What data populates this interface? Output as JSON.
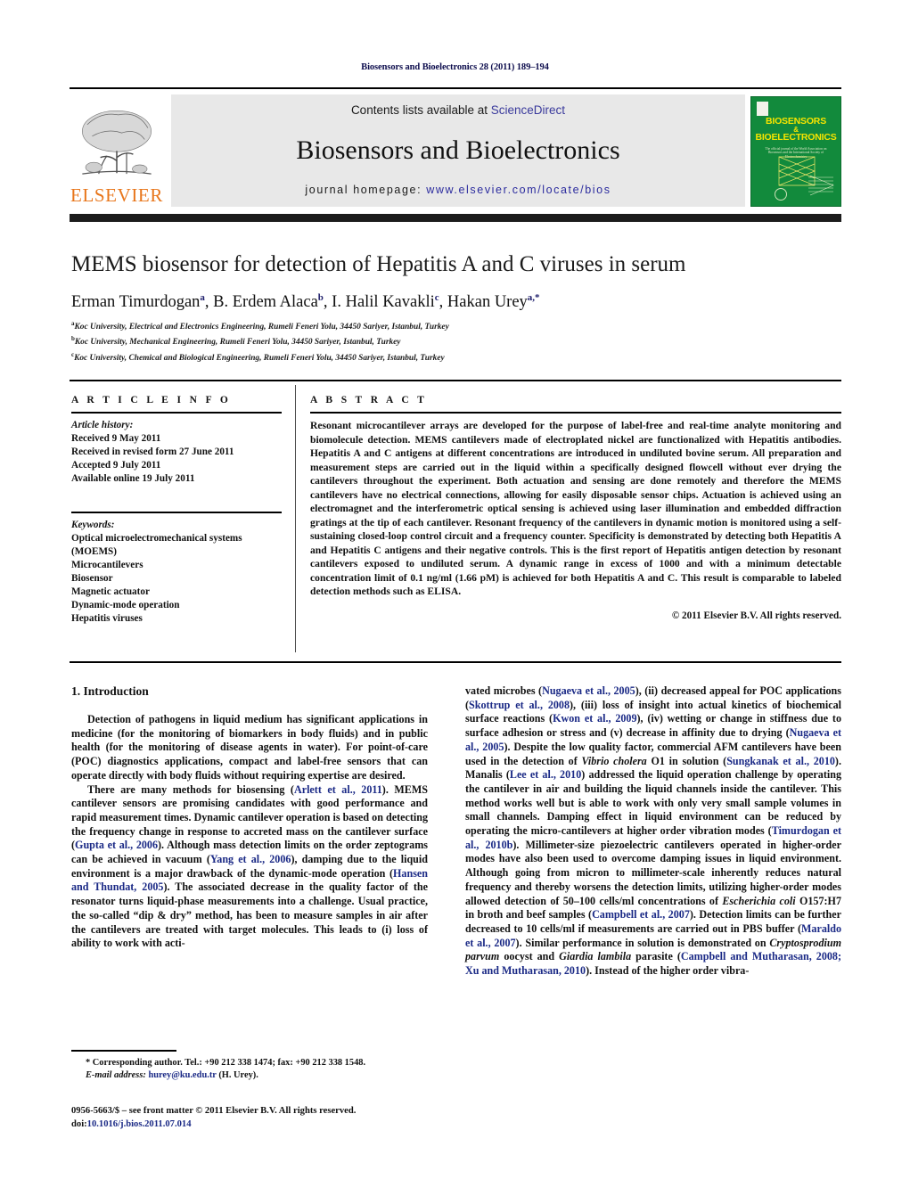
{
  "running_head": "Biosensors and Bioelectronics 28 (2011) 189–194",
  "masthead": {
    "contents_prefix": "Contents lists available at ",
    "sciencedirect": "ScienceDirect",
    "journal_name": "Biosensors and Bioelectronics",
    "homepage_prefix": "journal homepage: ",
    "homepage_url": "www.elsevier.com/locate/bios",
    "publisher": "ELSEVIER",
    "cover": {
      "line1": "BIOSENSORS",
      "amp": "&",
      "line2": "BIOELECTRONICS",
      "subtitle": "The official journal of the World Association on Biosensors and the International Society of Electrochemistry"
    },
    "accent_orange": "#e8761b",
    "accent_blue": "#2b2b9e",
    "cover_green": "#128a3c",
    "cover_yellow": "#f6e400"
  },
  "article": {
    "title": "MEMS biosensor for detection of Hepatitis A and C viruses in serum",
    "authors": [
      {
        "name": "Erman Timurdogan",
        "sup": "a"
      },
      {
        "name": "B. Erdem Alaca",
        "sup": "b"
      },
      {
        "name": "I. Halil Kavakli",
        "sup": "c"
      },
      {
        "name": "Hakan Urey",
        "sup": "a,*"
      }
    ],
    "affiliations": [
      {
        "sup": "a",
        "text": "Koc University, Electrical and Electronics Engineering, Rumeli Feneri Yolu, 34450 Sariyer, Istanbul, Turkey"
      },
      {
        "sup": "b",
        "text": "Koc University, Mechanical Engineering, Rumeli Feneri Yolu, 34450 Sariyer, Istanbul, Turkey"
      },
      {
        "sup": "c",
        "text": "Koc University, Chemical and Biological Engineering, Rumeli Feneri Yolu, 34450 Sariyer, Istanbul, Turkey"
      }
    ]
  },
  "article_info": {
    "heading": "A R T I C L E    I N F O",
    "history_label": "Article history:",
    "history": [
      "Received 9 May 2011",
      "Received in revised form 27 June 2011",
      "Accepted 9 July 2011",
      "Available online 19 July 2011"
    ],
    "keywords_label": "Keywords:",
    "keywords": [
      "Optical microelectromechanical systems",
      "(MOEMS)",
      "Microcantilevers",
      "Biosensor",
      "Magnetic actuator",
      "Dynamic-mode operation",
      "Hepatitis viruses"
    ]
  },
  "abstract": {
    "heading": "A B S T R A C T",
    "text": "Resonant microcantilever arrays are developed for the purpose of label-free and real-time analyte monitoring and biomolecule detection. MEMS cantilevers made of electroplated nickel are functionalized with Hepatitis antibodies. Hepatitis A and C antigens at different concentrations are introduced in undiluted bovine serum. All preparation and measurement steps are carried out in the liquid within a specifically designed flowcell without ever drying the cantilevers throughout the experiment. Both actuation and sensing are done remotely and therefore the MEMS cantilevers have no electrical connections, allowing for easily disposable sensor chips. Actuation is achieved using an electromagnet and the interferometric optical sensing is achieved using laser illumination and embedded diffraction gratings at the tip of each cantilever. Resonant frequency of the cantilevers in dynamic motion is monitored using a self-sustaining closed-loop control circuit and a frequency counter. Specificity is demonstrated by detecting both Hepatitis A and Hepatitis C antigens and their negative controls. This is the first report of Hepatitis antigen detection by resonant cantilevers exposed to undiluted serum. A dynamic range in excess of 1000 and with a minimum detectable concentration limit of 0.1 ng/ml (1.66 pM) is achieved for both Hepatitis A and C. This result is comparable to labeled detection methods such as ELISA.",
    "copyright": "© 2011 Elsevier B.V. All rights reserved."
  },
  "introduction": {
    "heading": "1.  Introduction",
    "left_paragraphs": [
      "Detection of pathogens in liquid medium has significant applications in medicine (for the monitoring of biomarkers in body fluids) and in public health (for the monitoring of disease agents in water). For point-of-care (POC) diagnostics applications, compact and label-free sensors that can operate directly with body fluids without requiring expertise are desired."
    ],
    "left_p2_segments": [
      {
        "t": "There are many methods for biosensing ("
      },
      {
        "t": "Arlett et al., 2011",
        "k": "ref"
      },
      {
        "t": "). MEMS cantilever sensors are promising candidates with good performance and rapid measurement times. Dynamic cantilever operation is based on detecting the frequency change in response to accreted mass on the cantilever surface ("
      },
      {
        "t": "Gupta et al., 2006",
        "k": "ref"
      },
      {
        "t": "). Although mass detection limits on the order zeptograms can be achieved in vacuum ("
      },
      {
        "t": "Yang et al., 2006",
        "k": "ref"
      },
      {
        "t": "), damping due to the liquid environment is a major drawback of the dynamic-mode operation ("
      },
      {
        "t": "Hansen and Thundat, 2005",
        "k": "ref"
      },
      {
        "t": "). The associated decrease in the quality factor of the resonator turns liquid-phase measurements into a challenge. Usual practice, the so-called “dip & dry” method, has been to measure samples in air after the cantilevers are treated with target molecules. This leads to (i) loss of ability to work with acti-"
      }
    ],
    "right_segments": [
      {
        "t": "vated microbes ("
      },
      {
        "t": "Nugaeva et al., 2005",
        "k": "ref"
      },
      {
        "t": "), (ii) decreased appeal for POC applications ("
      },
      {
        "t": "Skottrup et al., 2008",
        "k": "ref"
      },
      {
        "t": "), (iii) loss of insight into actual kinetics of biochemical surface reactions ("
      },
      {
        "t": "Kwon et al., 2009",
        "k": "ref"
      },
      {
        "t": "), (iv) wetting or change in stiffness due to surface adhesion or stress and (v) decrease in affinity due to drying ("
      },
      {
        "t": "Nugaeva et al., 2005",
        "k": "ref"
      },
      {
        "t": "). Despite the low quality factor, commercial AFM cantilevers have been used in the detection of "
      },
      {
        "t": "Vibrio cholera",
        "k": "it"
      },
      {
        "t": " O1 in solution ("
      },
      {
        "t": "Sungkanak et al., 2010",
        "k": "ref"
      },
      {
        "t": "). Manalis ("
      },
      {
        "t": "Lee et al., 2010",
        "k": "ref"
      },
      {
        "t": ") addressed the liquid operation challenge by operating the cantilever in air and building the liquid channels inside the cantilever. This method works well but is able to work with only very small sample volumes in small channels. Damping effect in liquid environment can be reduced by operating the micro-cantilevers at higher order vibration modes ("
      },
      {
        "t": "Timurdogan et al., 2010b",
        "k": "ref"
      },
      {
        "t": "). Millimeter-size piezoelectric cantilevers operated in higher-order modes have also been used to overcome damping issues in liquid environment. Although going from micron to millimeter-scale inherently reduces natural frequency and thereby worsens the detection limits, utilizing higher-order modes allowed detection of 50–100 cells/ml concentrations of "
      },
      {
        "t": "Escherichia coli",
        "k": "it"
      },
      {
        "t": " O157:H7 in broth and beef samples ("
      },
      {
        "t": "Campbell et al., 2007",
        "k": "ref"
      },
      {
        "t": "). Detection limits can be further decreased to 10 cells/ml if measurements are carried out in PBS buffer ("
      },
      {
        "t": "Maraldo et al., 2007",
        "k": "ref"
      },
      {
        "t": "). Similar performance in solution is demonstrated on "
      },
      {
        "t": "Cryptosprodium parvum",
        "k": "it"
      },
      {
        "t": " oocyst and "
      },
      {
        "t": "Giardia lambila",
        "k": "it"
      },
      {
        "t": " parasite ("
      },
      {
        "t": "Campbell and Mutharasan, 2008; Xu and Mutharasan, 2010",
        "k": "ref"
      },
      {
        "t": "). Instead of the higher order vibra-"
      }
    ]
  },
  "footnote": {
    "star": "*",
    "corresponding": " Corresponding author. Tel.: +90 212 338 1474; fax: +90 212 338 1548.",
    "email_label": "E-mail address:",
    "email": "hurey@ku.edu.tr",
    "email_suffix": " (H. Urey)."
  },
  "imprint": {
    "line1": "0956-5663/$ – see front matter © 2011 Elsevier B.V. All rights reserved.",
    "doi_label": "doi:",
    "doi": "10.1016/j.bios.2011.07.014"
  }
}
